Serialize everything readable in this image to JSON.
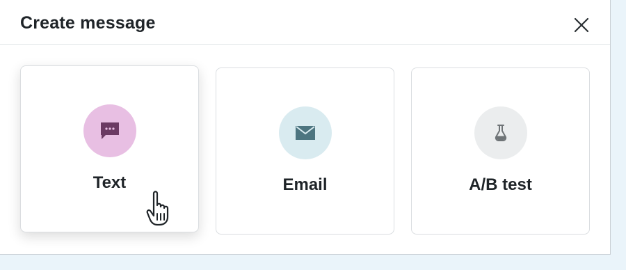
{
  "dialog": {
    "title": "Create message",
    "close_icon": "close-icon"
  },
  "options": [
    {
      "label": "Text",
      "icon": "chat-bubble-icon",
      "icon_bg": "#e8bfe3",
      "icon_color": "#6b3a63"
    },
    {
      "label": "Email",
      "icon": "envelope-icon",
      "icon_bg": "#d9ebf0",
      "icon_color": "#4d7580"
    },
    {
      "label": "A/B test",
      "icon": "flask-icon",
      "icon_bg": "#ebedee",
      "icon_color": "#6f7477"
    }
  ],
  "cursor": {
    "icon": "hand-pointer-icon",
    "hovered_option": "Text"
  }
}
